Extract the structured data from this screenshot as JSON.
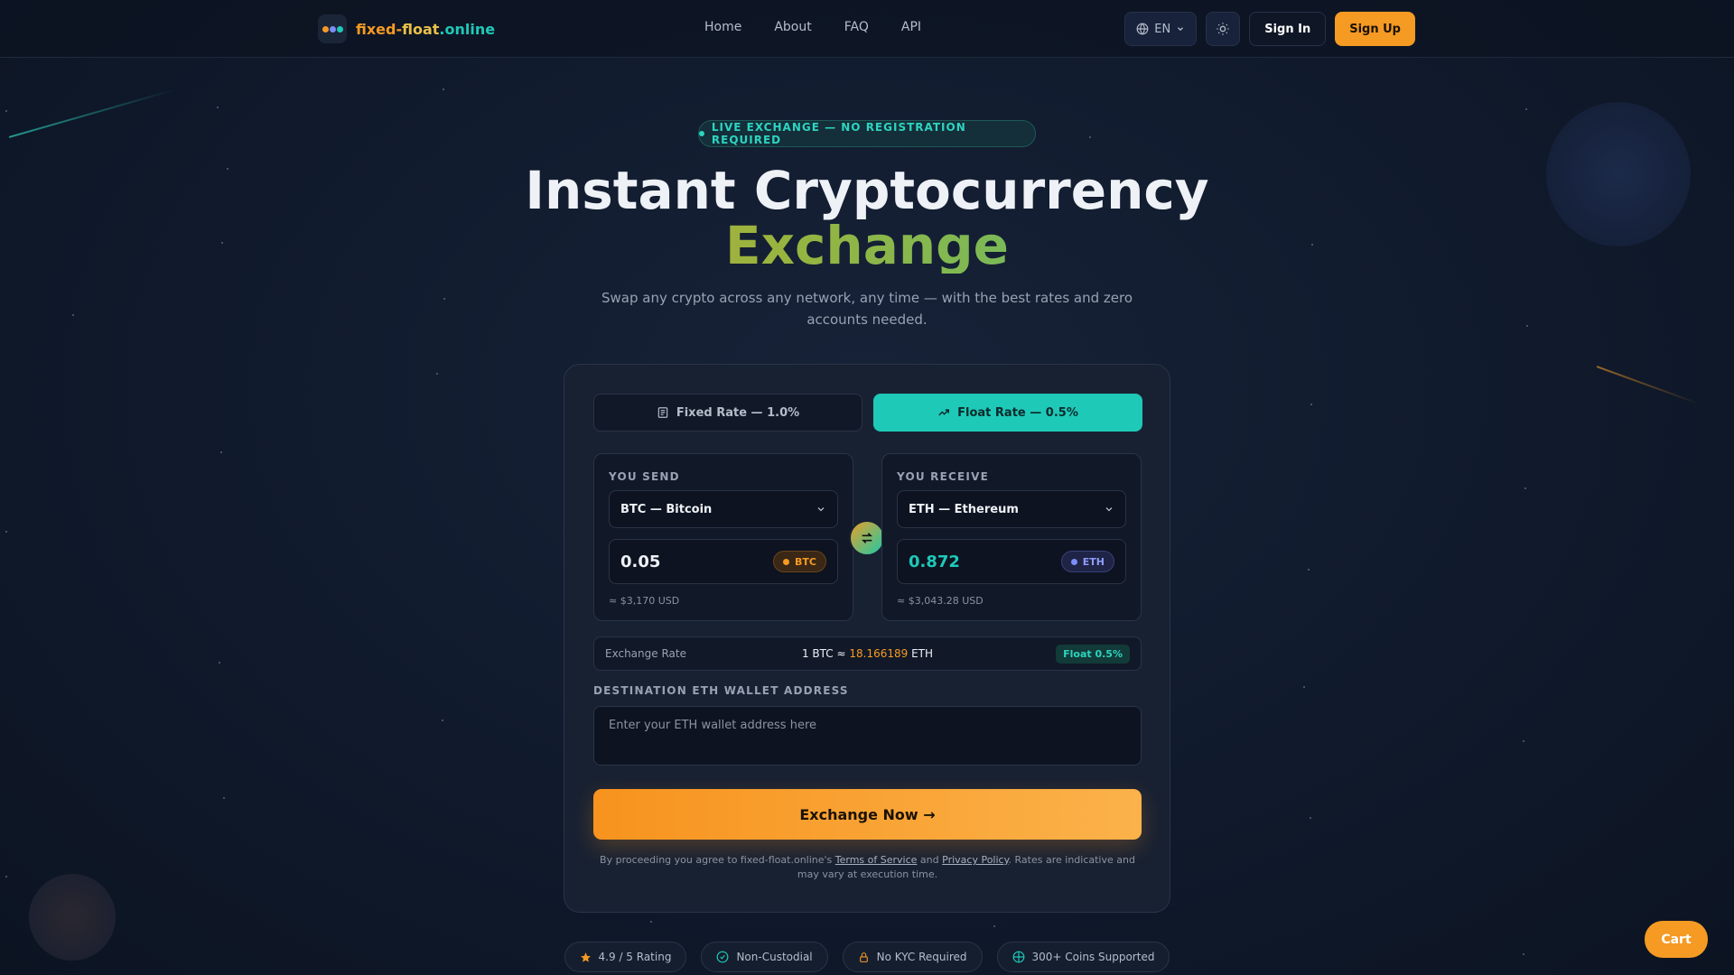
{
  "nav": {
    "brand": {
      "part1": "fixed-",
      "part2": "float",
      "part3": ".online"
    },
    "links": [
      "Home",
      "About",
      "FAQ",
      "API"
    ],
    "language": "EN",
    "sign_in": "Sign In",
    "sign_up": "Sign Up"
  },
  "hero": {
    "badge": "LIVE EXCHANGE — NO REGISTRATION REQUIRED",
    "title_line1": "Instant Cryptocurrency",
    "title_line2": "Exchange",
    "subtitle": "Swap any crypto across any network, any time — with the best rates and zero accounts needed."
  },
  "exchange": {
    "tabs": {
      "fixed": "Fixed Rate — 1.0%",
      "float": "Float Rate — 0.5%"
    },
    "send": {
      "label": "YOU SEND",
      "currency": "BTC — Bitcoin",
      "amount": "0.05",
      "ticker": "BTC",
      "usd": "≈ $3,170 USD"
    },
    "receive": {
      "label": "YOU RECEIVE",
      "currency": "ETH — Ethereum",
      "amount": "0.872",
      "ticker": "ETH",
      "usd": "≈ $3,043.28 USD"
    },
    "rate": {
      "label": "Exchange Rate",
      "prefix": "1 BTC ≈ ",
      "value": "18.166189",
      "suffix": " ETH",
      "badge": "Float 0.5%"
    },
    "address": {
      "label": "DESTINATION ETH WALLET ADDRESS",
      "placeholder": "Enter your ETH wallet address here",
      "value": ""
    },
    "cta": "Exchange Now →",
    "terms": {
      "prefix": "By proceeding you agree to fixed-float.online's ",
      "tos": "Terms of Service",
      "and": " and ",
      "privacy": "Privacy Policy",
      "suffix": ". Rates are indicative and may vary at execution time."
    }
  },
  "features": [
    "4.9 / 5 Rating",
    "Non-Custodial",
    "No KYC Required",
    "300+ Coins Supported"
  ],
  "cart": "Cart",
  "colors": {
    "accent": "#f59a23",
    "teal": "#1ec9b8",
    "btc": "#f7931e",
    "eth": "#7c8cf8"
  }
}
